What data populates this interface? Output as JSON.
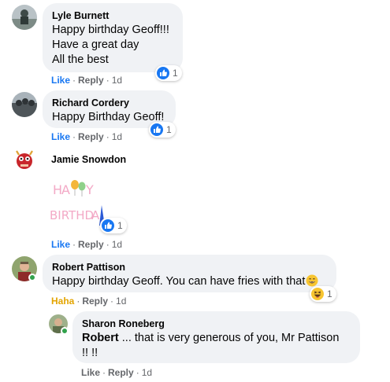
{
  "comments": [
    {
      "author": "Lyle Burnett",
      "lines": [
        "Happy birthday Geoff!!!",
        "Have a great day",
        "All the best"
      ],
      "actions": {
        "like": "Like",
        "reply": "Reply",
        "time": "1d"
      },
      "reaction": {
        "icon": "like-icon",
        "count": "1"
      }
    },
    {
      "author": "Richard Cordery",
      "lines": [
        "Happy Birthday Geoff!"
      ],
      "actions": {
        "like": "Like",
        "reply": "Reply",
        "time": "1d"
      },
      "reaction": {
        "icon": "like-icon",
        "count": "1"
      }
    },
    {
      "author": "Jamie Snowdon",
      "sticker": "HAPPY BIRTHDAY",
      "actions": {
        "like": "Like",
        "reply": "Reply",
        "time": "1d"
      },
      "reaction": {
        "icon": "like-icon",
        "count": "1"
      }
    },
    {
      "author": "Robert Pattison",
      "lines": [
        "Happy birthday Geoff. You can have fries with that"
      ],
      "emoji": "grinning-face-emoji",
      "actions": {
        "like": "Haha",
        "reply": "Reply",
        "time": "1d"
      },
      "reaction": {
        "icon": "haha-icon",
        "count": "1"
      }
    }
  ],
  "reply": {
    "author": "Sharon Roneberg",
    "mention": "Robert",
    "text_line1": " ... that is very generous of you, Mr Pattison",
    "text_line2": "!! !!",
    "actions": {
      "like": "Like",
      "reply": "Reply",
      "time": "1d"
    }
  },
  "colors": {
    "bubble_bg": "#f0f2f5",
    "meta_text": "#65676b",
    "like_blue": "#1877f2",
    "haha_yellow": "#e3a400",
    "online_green": "#31a24c"
  }
}
